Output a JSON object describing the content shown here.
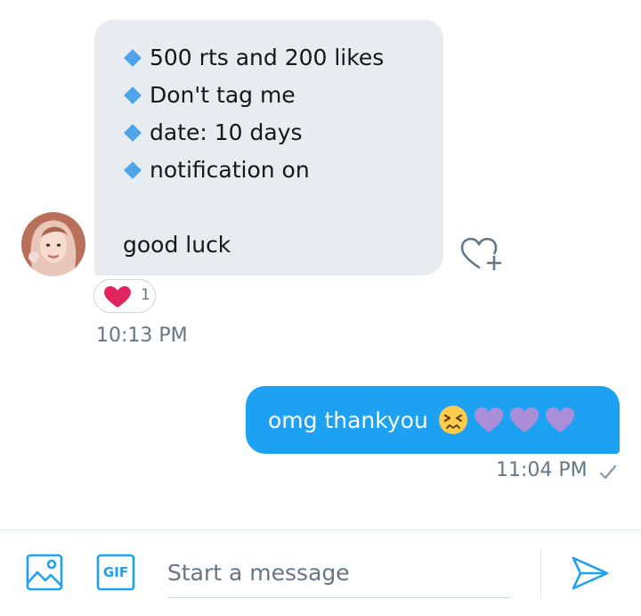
{
  "conversation": {
    "received": {
      "lines": [
        "500 rts and 200 likes",
        "Don't tag me",
        "date: 10 days",
        "notification on"
      ],
      "closing": "good luck",
      "reaction_count": "1",
      "time": "10:13 PM"
    },
    "sent": {
      "text": "omg thankyou",
      "time": "11:04 PM"
    }
  },
  "composer": {
    "placeholder": "Start a message",
    "gif_label": "GIF"
  },
  "colors": {
    "accent": "#1da1f2",
    "bubble_received": "#e6ecf0",
    "bullet": "#4ea4e8",
    "reaction_heart": "#e0245e",
    "purple_heart": "#ab8ed8",
    "muted_text": "#657786"
  },
  "icons": [
    "blue-diamond-icon",
    "heart-add-icon",
    "red-heart-icon",
    "persevering-face-icon",
    "purple-heart-icon",
    "check-icon",
    "image-icon",
    "gif-icon",
    "send-icon"
  ]
}
